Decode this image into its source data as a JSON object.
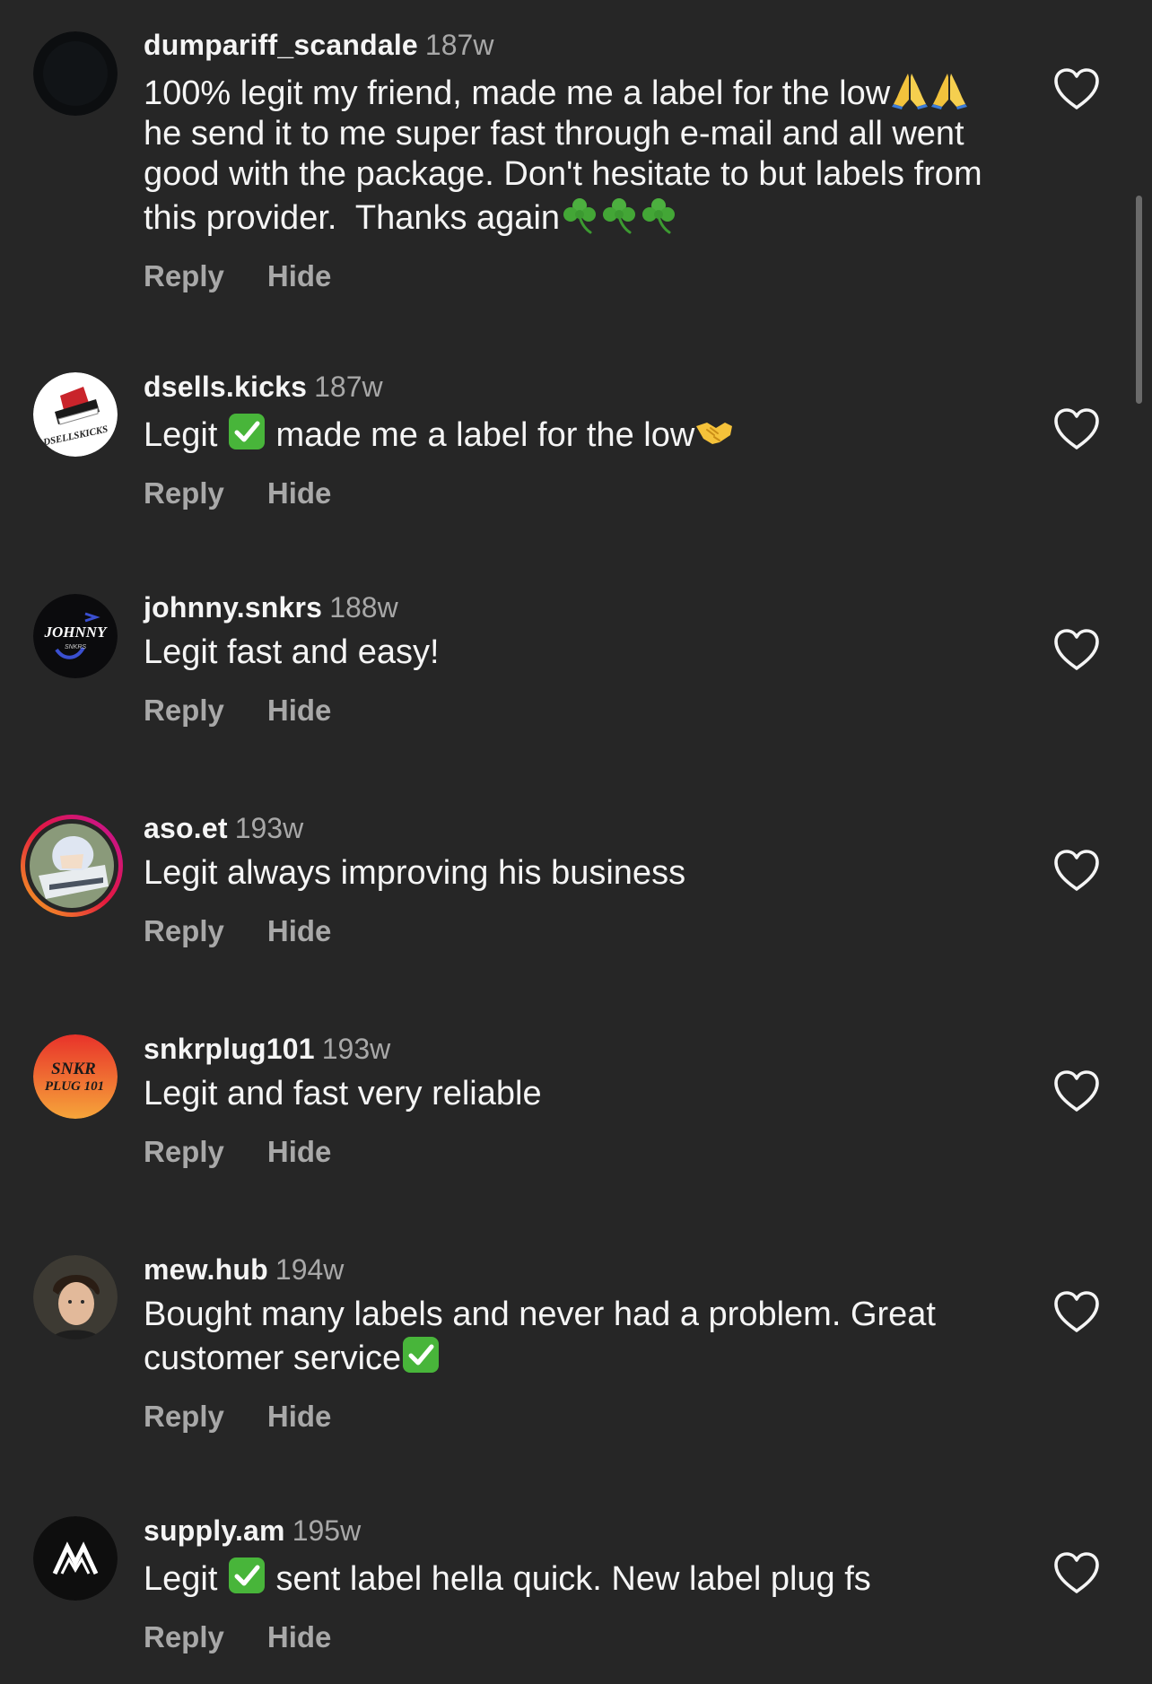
{
  "comments": [
    {
      "username": "dumpariff_scandale",
      "time": "187w",
      "text_parts": [
        "100% legit my friend, made me a label for the low",
        " he send it to me super fast through e-mail and all went good with the package. Don't hesitate to but labels from this provider.  Thanks again"
      ],
      "reply_label": "Reply",
      "hide_label": "Hide"
    },
    {
      "username": "dsells.kicks",
      "time": "187w",
      "text_parts": [
        "Legit ",
        " made me a label for the low"
      ],
      "avatar_text": "DSELLSKICKS",
      "reply_label": "Reply",
      "hide_label": "Hide"
    },
    {
      "username": "johnny.snkrs",
      "time": "188w",
      "text_parts": [
        "Legit fast and easy!"
      ],
      "avatar_text": "JOHNNY",
      "avatar_subtext": "SNKRS",
      "reply_label": "Reply",
      "hide_label": "Hide"
    },
    {
      "username": "aso.et",
      "time": "193w",
      "text_parts": [
        "Legit always improving his business"
      ],
      "reply_label": "Reply",
      "hide_label": "Hide"
    },
    {
      "username": "snkrplug101",
      "time": "193w",
      "text_parts": [
        "Legit and fast very reliable"
      ],
      "avatar_text": "SNKR",
      "avatar_subtext": "PLUG 101",
      "reply_label": "Reply",
      "hide_label": "Hide"
    },
    {
      "username": "mew.hub",
      "time": "194w",
      "text_parts": [
        "Bought many labels and never had a problem. Great customer service"
      ],
      "reply_label": "Reply",
      "hide_label": "Hide"
    },
    {
      "username": "supply.am",
      "time": "195w",
      "text_parts": [
        "Legit ",
        " sent label hella quick. New label plug fs"
      ],
      "reply_label": "Reply",
      "hide_label": "Hide"
    }
  ],
  "icons": {
    "like": "heart-outline-icon",
    "emojis": [
      "folded-hands",
      "shamrock",
      "check-mark-button",
      "handshake"
    ]
  },
  "colors": {
    "background": "#262626",
    "primary_text": "#f5f5f5",
    "secondary_text": "#a8a8a8",
    "check_green": "#48b53a"
  }
}
